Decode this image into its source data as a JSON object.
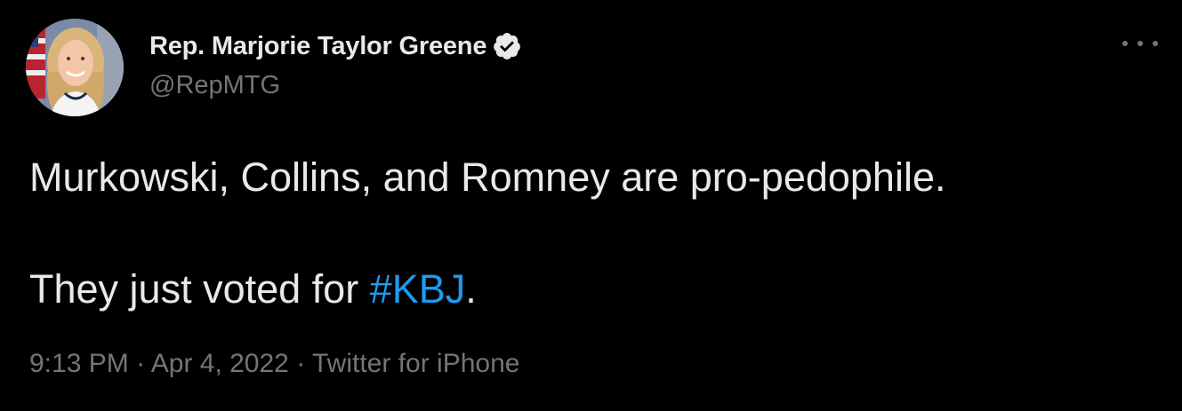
{
  "author": {
    "display_name": "Rep. Marjorie Taylor Greene",
    "handle": "@RepMTG",
    "verified": true
  },
  "more_icon": "ellipsis-icon",
  "tweet": {
    "line1": "Murkowski, Collins, and Romney are pro-pedophile.",
    "line2_prefix": "They just voted for ",
    "hashtag": "#KBJ",
    "line2_suffix": "."
  },
  "meta": {
    "time": "9:13 PM",
    "separator": "·",
    "date": "Apr 4, 2022",
    "source": "Twitter for iPhone"
  },
  "colors": {
    "background": "#000000",
    "text": "#e7e9ea",
    "muted": "#71767b",
    "link": "#1d9bf0"
  }
}
